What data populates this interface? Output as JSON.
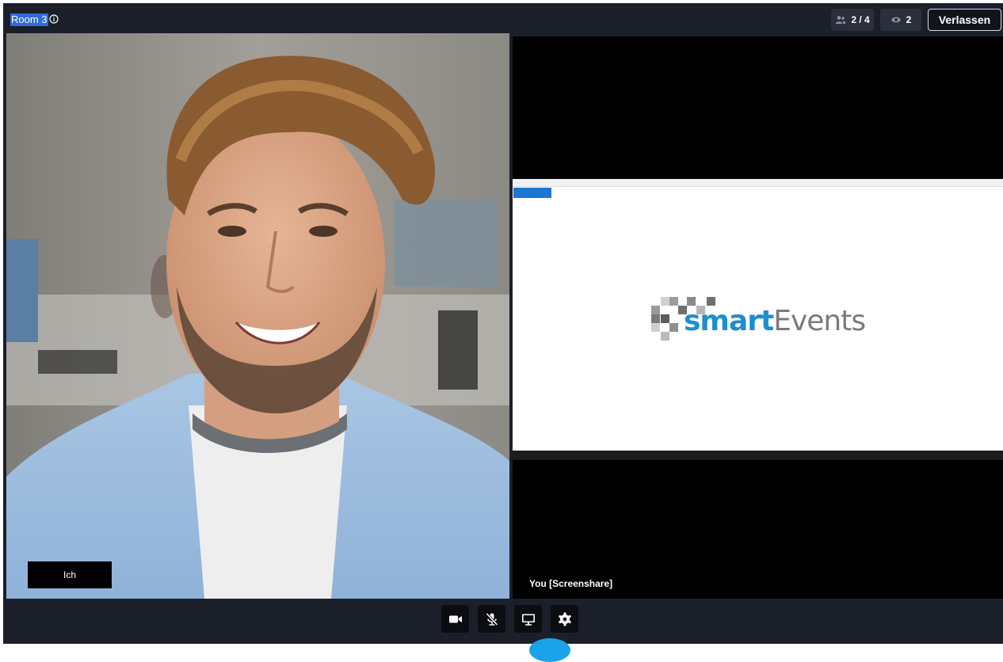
{
  "room": {
    "title": "Room 3"
  },
  "header": {
    "participants": "2 / 4",
    "viewers": "2",
    "leave_label": "Verlassen"
  },
  "local_video": {
    "name_label": "Ich"
  },
  "screenshare": {
    "label": "You [Screenshare]",
    "logo_part1": "smart",
    "logo_part2": "Events"
  },
  "controls": {
    "camera": "camera-icon",
    "microphone": "mic-muted-icon",
    "screenshare": "monitor-icon",
    "settings": "gear-icon"
  },
  "colors": {
    "background": "#1b1f29",
    "accent": "#1aa3e8",
    "brand_blue": "#1d8ecf"
  }
}
